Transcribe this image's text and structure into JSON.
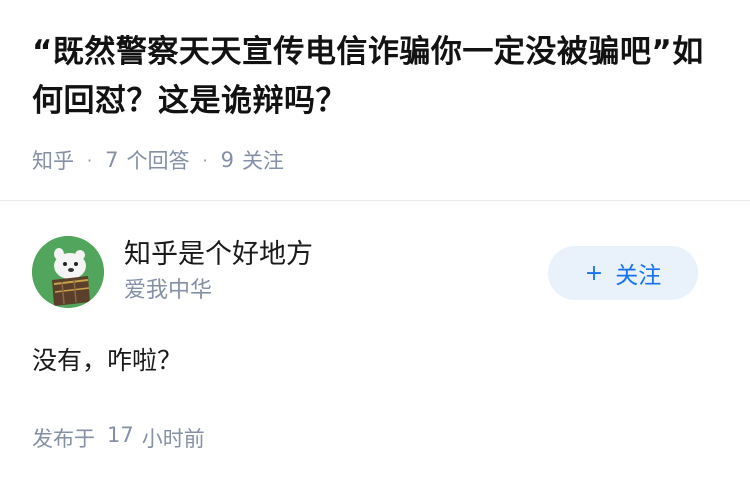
{
  "question": {
    "title": "“既然警察天天宣传电信诈骗你一定没被骗吧”如何回怼？这是诡辩吗？",
    "site": "知乎",
    "answer_count": "7",
    "answer_label": "个回答",
    "follower_count": "9",
    "follower_label": "关注"
  },
  "answer": {
    "author_name": "知乎是个好地方",
    "author_bio": "爱我中华",
    "follow_button": "关注",
    "follow_icon": "plus-icon",
    "content": "没有，咋啦？",
    "time_prefix": "发布于",
    "time_value": "17",
    "time_suffix": "小时前"
  },
  "colors": {
    "accent": "#1772f6",
    "follow_bg": "#e9f1fb",
    "meta_gray": "#8590a6",
    "avatar_bg": "#52a55c"
  }
}
